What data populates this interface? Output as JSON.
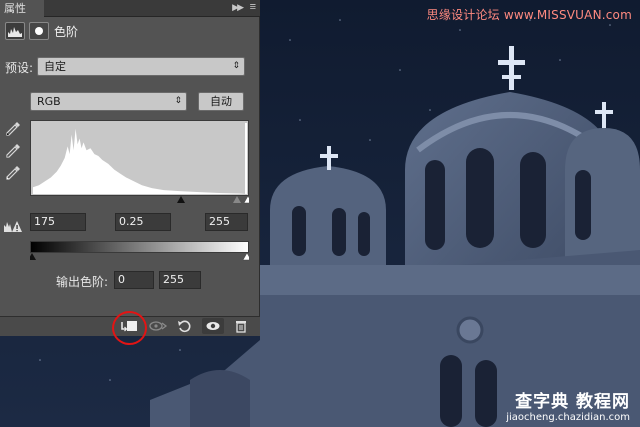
{
  "panel": {
    "tab_label": "属性",
    "collapse_icon": "double-chevron-right-icon",
    "menu_icon": "panel-menu-icon",
    "adjustment_title": "色阶",
    "preset": {
      "label": "预设:",
      "value": "自定"
    },
    "channel": {
      "value": "RGB"
    },
    "auto_label": "自动",
    "input_levels": {
      "black": "175",
      "gamma": "0.25",
      "white": "255"
    },
    "output": {
      "label": "输出色阶:",
      "black": "0",
      "white": "255"
    },
    "footer_buttons": [
      "clip-to-layer-icon",
      "view-previous-icon",
      "reset-icon",
      "visibility-eye-icon",
      "trash-icon"
    ]
  },
  "watermark": {
    "top": "思缘设计论坛 www.MISSVUAN.com",
    "bottom_cn": "查字典 教程网",
    "bottom_url": "jiaocheng.chazidian.com"
  },
  "colors": {
    "highlight": "#e21414",
    "panel_bg": "#535353",
    "sky": "#0f1a2e"
  }
}
